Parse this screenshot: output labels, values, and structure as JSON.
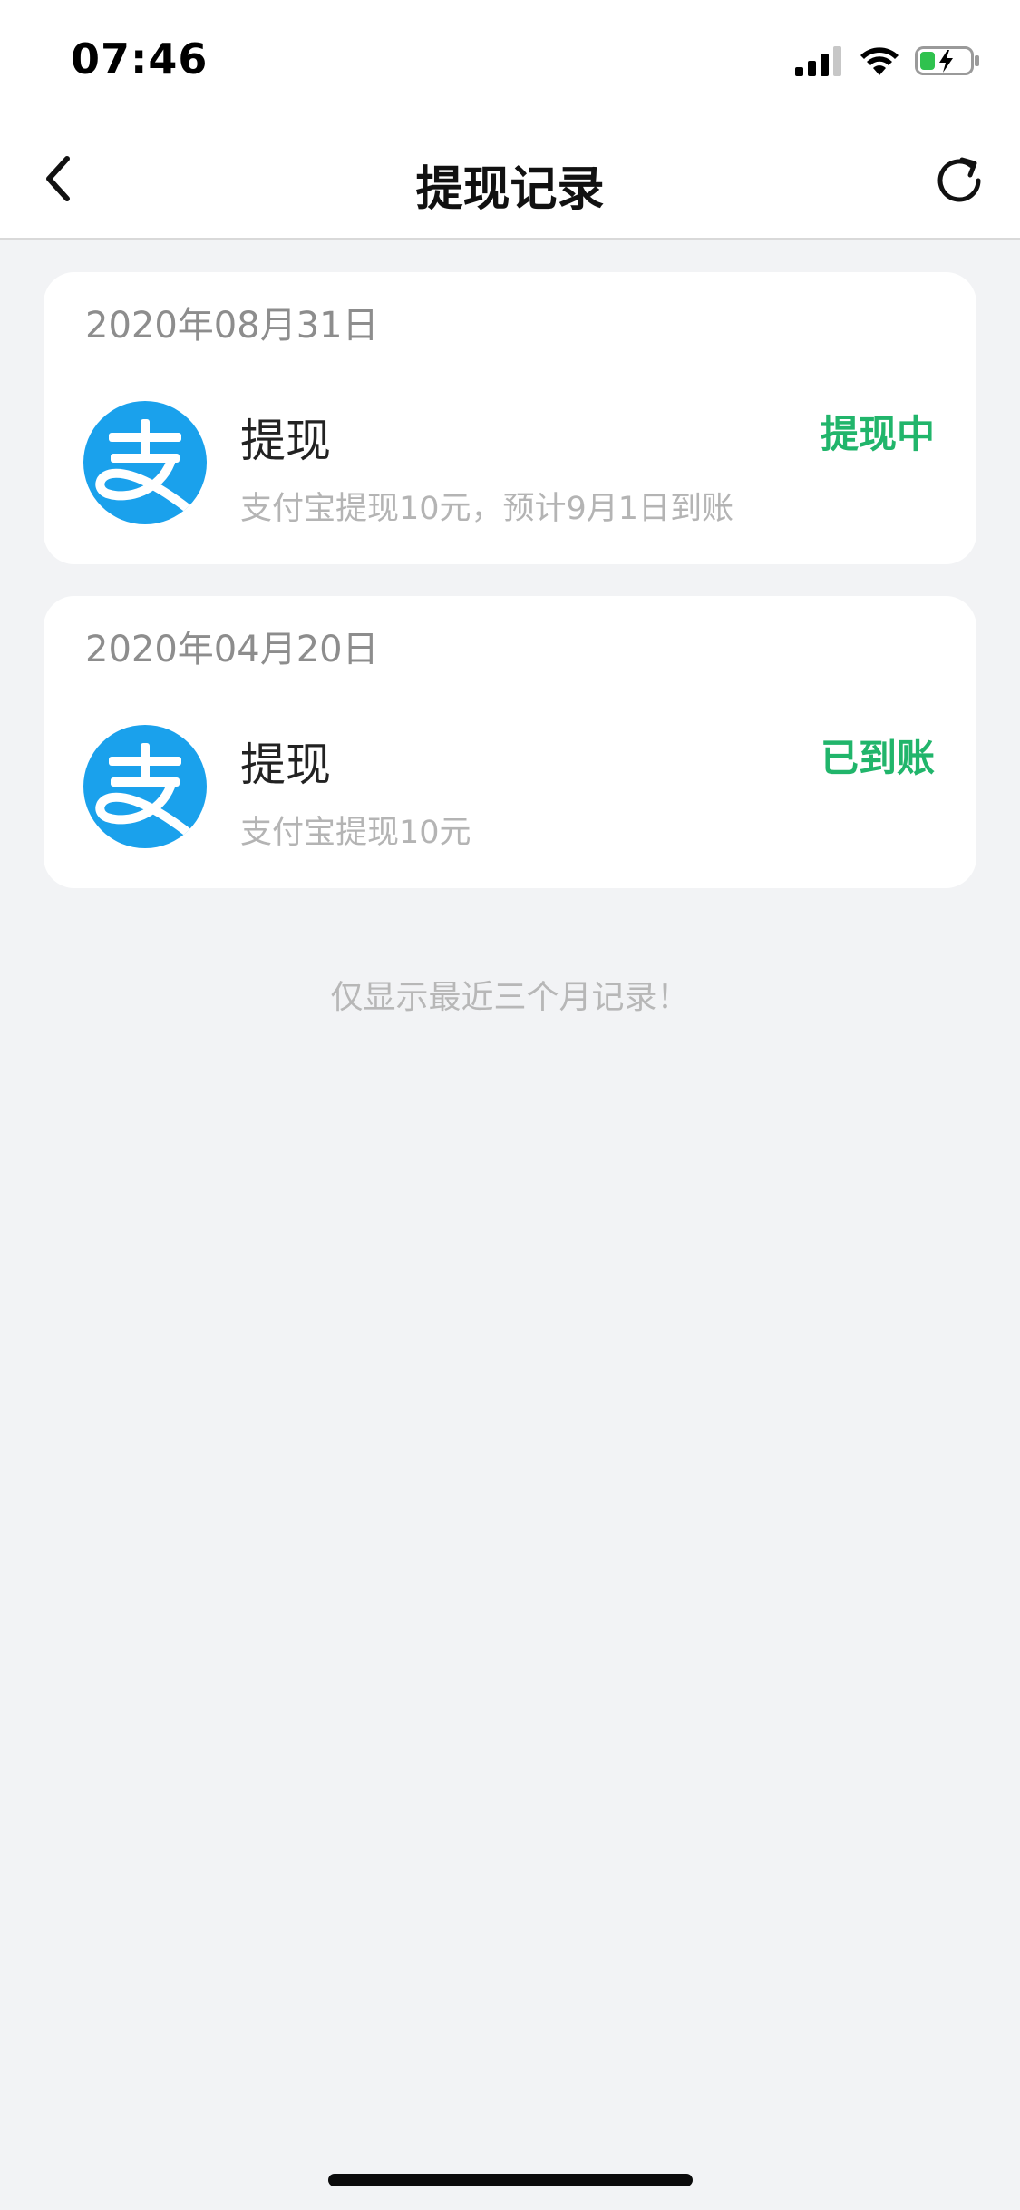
{
  "status_bar": {
    "time": "07:46",
    "icons": [
      "cellular-signal-icon",
      "wifi-icon",
      "battery-charging-icon"
    ]
  },
  "nav": {
    "title": "提现记录",
    "back_icon": "chevron-left-icon",
    "refresh_icon": "refresh-icon"
  },
  "records": [
    {
      "date": "2020年08月31日",
      "logo_icon": "alipay-logo-icon",
      "logo_color": "#1aa1ec",
      "title": "提现",
      "desc": "支付宝提现10元，预计9月1日到账",
      "status": "提现中"
    },
    {
      "date": "2020年04月20日",
      "logo_icon": "alipay-logo-icon",
      "logo_color": "#1aa1ec",
      "title": "提现",
      "desc": "支付宝提现10元",
      "status": "已到账"
    }
  ],
  "footer_note": "仅显示最近三个月记录！",
  "colors": {
    "status_green": "#21b56b",
    "background": "#f2f3f5",
    "alipay_blue": "#1aa1ec"
  }
}
